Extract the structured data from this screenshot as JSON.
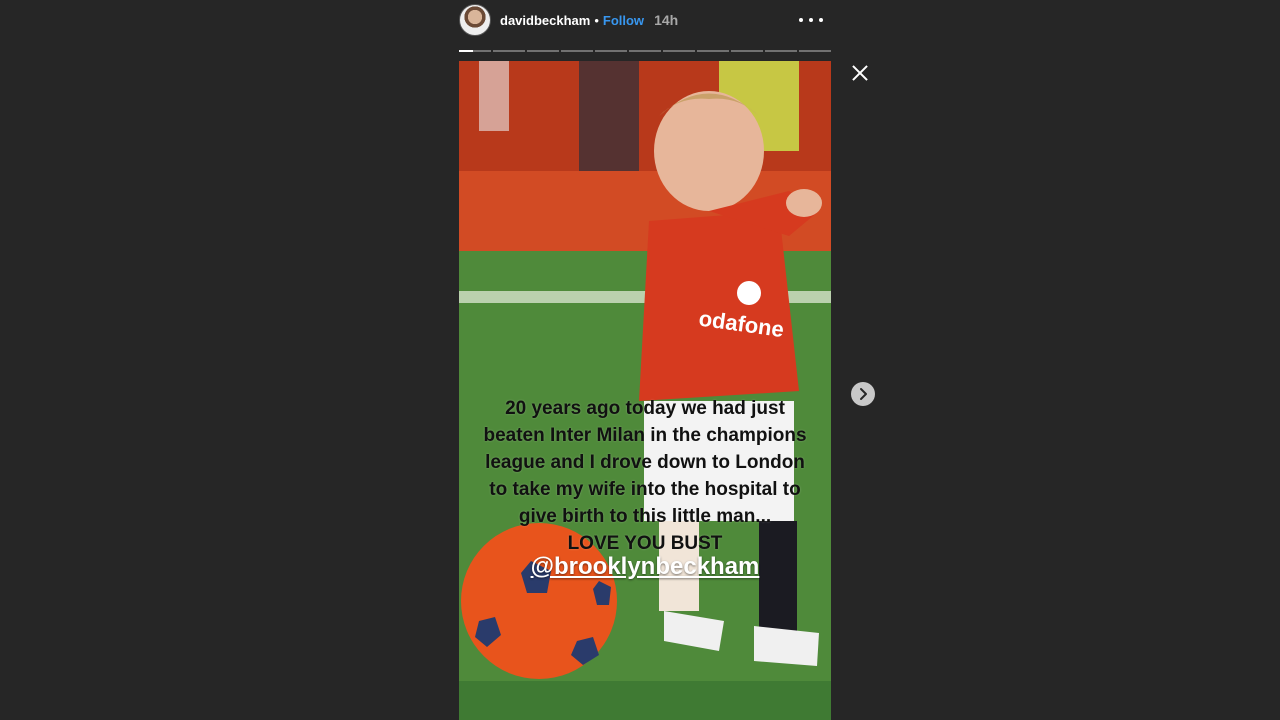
{
  "header": {
    "username": "davidbeckham",
    "separator": "•",
    "follow_label": "Follow",
    "time": "14h"
  },
  "progress": {
    "segments": 11,
    "current_index": 0,
    "current_fraction": 0.45
  },
  "story": {
    "caption_lines": [
      "20 years ago today we had just",
      "beaten Inter Milan in the champions",
      "league  and I drove down to London",
      "to take my wife into the hospital to",
      "give birth to this little man...",
      "LOVE YOU BUST"
    ],
    "mention": "@brooklynbeckham"
  },
  "icons": {
    "more": "more-options-icon",
    "close": "close-icon",
    "next": "chevron-right-icon"
  },
  "colors": {
    "background": "#262626",
    "follow": "#3897f0",
    "time": "#a8a8a8"
  }
}
